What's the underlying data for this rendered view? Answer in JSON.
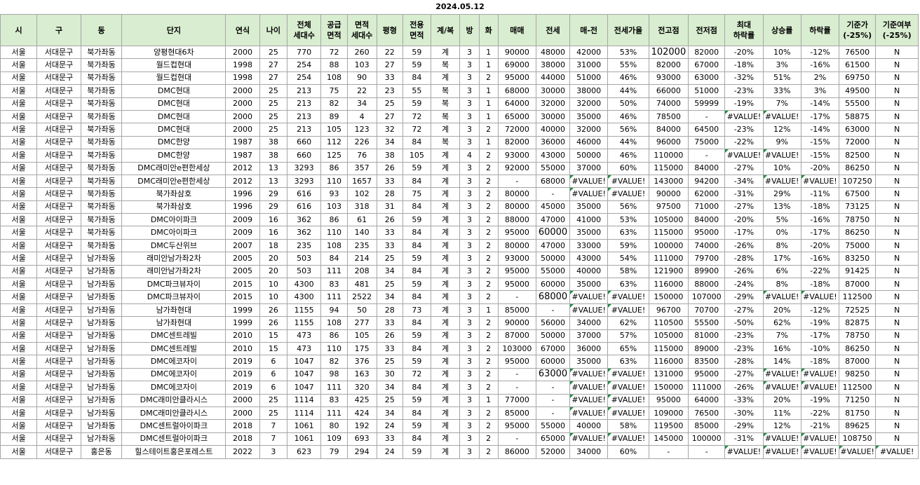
{
  "date": "2024.05.12",
  "headers": [
    "시",
    "구",
    "동",
    "단지",
    "연식",
    "나이",
    "전체\n세대수",
    "공급\n면적",
    "면적\n세대수",
    "평형",
    "전용\n면적",
    "계/복",
    "방",
    "화",
    "매매",
    "전세",
    "매-전",
    "전세가율",
    "전고점",
    "전저점",
    "최대\n하락률",
    "상승률",
    "하락률",
    "기준가\n(-25%)",
    "기준여부\n(-25%)"
  ],
  "rows": [
    [
      "서울",
      "서대문구",
      "북가좌동",
      "양평현대6차",
      "2000",
      "25",
      "770",
      "72",
      "260",
      "22",
      "59",
      "계",
      "3",
      "1",
      "90000",
      "48000",
      "42000",
      "53%",
      "102000",
      "82000",
      "-20%",
      "10%",
      "-12%",
      "76500",
      "N"
    ],
    [
      "서울",
      "서대문구",
      "북가좌동",
      "월드컵현대",
      "1998",
      "27",
      "254",
      "88",
      "103",
      "27",
      "59",
      "복",
      "3",
      "1",
      "69000",
      "38000",
      "31000",
      "55%",
      "82000",
      "67000",
      "-18%",
      "3%",
      "-16%",
      "61500",
      "N"
    ],
    [
      "서울",
      "서대문구",
      "북가좌동",
      "월드컵현대",
      "1998",
      "27",
      "254",
      "108",
      "90",
      "33",
      "84",
      "계",
      "3",
      "2",
      "95000",
      "44000",
      "51000",
      "46%",
      "93000",
      "63000",
      "-32%",
      "51%",
      "2%",
      "69750",
      "N"
    ],
    [
      "서울",
      "서대문구",
      "북가좌동",
      "DMC현대",
      "2000",
      "25",
      "213",
      "75",
      "22",
      "23",
      "55",
      "복",
      "3",
      "1",
      "68000",
      "30000",
      "38000",
      "44%",
      "66000",
      "51000",
      "-23%",
      "33%",
      "3%",
      "49500",
      "N"
    ],
    [
      "서울",
      "서대문구",
      "북가좌동",
      "DMC현대",
      "2000",
      "25",
      "213",
      "82",
      "34",
      "25",
      "59",
      "복",
      "3",
      "1",
      "64000",
      "32000",
      "32000",
      "50%",
      "74000",
      "59999",
      "-19%",
      "7%",
      "-14%",
      "55500",
      "N"
    ],
    [
      "서울",
      "서대문구",
      "북가좌동",
      "DMC현대",
      "2000",
      "25",
      "213",
      "89",
      "4",
      "27",
      "72",
      "복",
      "3",
      "1",
      "65000",
      "30000",
      "35000",
      "46%",
      "78500",
      "-",
      "#VALUE!",
      "#VALUE!",
      "-17%",
      "58875",
      "N"
    ],
    [
      "서울",
      "서대문구",
      "북가좌동",
      "DMC현대",
      "2000",
      "25",
      "213",
      "105",
      "123",
      "32",
      "72",
      "계",
      "3",
      "2",
      "72000",
      "40000",
      "32000",
      "56%",
      "84000",
      "64500",
      "-23%",
      "12%",
      "-14%",
      "63000",
      "N"
    ],
    [
      "서울",
      "서대문구",
      "북가좌동",
      "DMC한양",
      "1987",
      "38",
      "660",
      "112",
      "226",
      "34",
      "84",
      "복",
      "3",
      "1",
      "82000",
      "36000",
      "46000",
      "44%",
      "96000",
      "75000",
      "-22%",
      "9%",
      "-15%",
      "72000",
      "N"
    ],
    [
      "서울",
      "서대문구",
      "북가좌동",
      "DMC한양",
      "1987",
      "38",
      "660",
      "125",
      "76",
      "38",
      "105",
      "계",
      "4",
      "2",
      "93000",
      "43000",
      "50000",
      "46%",
      "110000",
      "-",
      "#VALUE!",
      "#VALUE!",
      "-15%",
      "82500",
      "N"
    ],
    [
      "서울",
      "서대문구",
      "북가좌동",
      "DMC래미안e편한세상",
      "2012",
      "13",
      "3293",
      "86",
      "357",
      "26",
      "59",
      "계",
      "3",
      "2",
      "92000",
      "55000",
      "37000",
      "60%",
      "115000",
      "84000",
      "-27%",
      "10%",
      "-20%",
      "86250",
      "N"
    ],
    [
      "서울",
      "서대문구",
      "북가좌동",
      "DMC래미안e편한세상",
      "2012",
      "13",
      "3293",
      "110",
      "1657",
      "33",
      "84",
      "계",
      "3",
      "2",
      "-",
      "68000",
      "#VALUE!",
      "#VALUE!",
      "143000",
      "94200",
      "-34%",
      "#VALUE!",
      "#VALUE!",
      "107250",
      "N"
    ],
    [
      "서울",
      "서대문구",
      "북가좌동",
      "북가좌삼호",
      "1996",
      "29",
      "616",
      "93",
      "102",
      "28",
      "75",
      "계",
      "3",
      "2",
      "80000",
      "-",
      "#VALUE!",
      "#VALUE!",
      "90000",
      "62000",
      "-31%",
      "29%",
      "-11%",
      "67500",
      "N"
    ],
    [
      "서울",
      "서대문구",
      "북가좌동",
      "북가좌삼호",
      "1996",
      "29",
      "616",
      "103",
      "318",
      "31",
      "84",
      "계",
      "3",
      "2",
      "80000",
      "45000",
      "35000",
      "56%",
      "97500",
      "71000",
      "-27%",
      "13%",
      "-18%",
      "73125",
      "N"
    ],
    [
      "서울",
      "서대문구",
      "북가좌동",
      "DMC아이파크",
      "2009",
      "16",
      "362",
      "86",
      "61",
      "26",
      "59",
      "계",
      "3",
      "2",
      "88000",
      "47000",
      "41000",
      "53%",
      "105000",
      "84000",
      "-20%",
      "5%",
      "-16%",
      "78750",
      "N"
    ],
    [
      "서울",
      "서대문구",
      "북가좌동",
      "DMC아이파크",
      "2009",
      "16",
      "362",
      "110",
      "140",
      "33",
      "84",
      "계",
      "3",
      "2",
      "95000",
      "60000",
      "35000",
      "63%",
      "115000",
      "95000",
      "-17%",
      "0%",
      "-17%",
      "86250",
      "N"
    ],
    [
      "서울",
      "서대문구",
      "북가좌동",
      "DMC두산위브",
      "2007",
      "18",
      "235",
      "108",
      "235",
      "33",
      "84",
      "계",
      "3",
      "2",
      "80000",
      "47000",
      "33000",
      "59%",
      "100000",
      "74000",
      "-26%",
      "8%",
      "-20%",
      "75000",
      "N"
    ],
    [
      "서울",
      "서대문구",
      "남가좌동",
      "래미안남가좌2차",
      "2005",
      "20",
      "503",
      "84",
      "214",
      "25",
      "59",
      "계",
      "3",
      "2",
      "93000",
      "50000",
      "43000",
      "54%",
      "111000",
      "79700",
      "-28%",
      "17%",
      "-16%",
      "83250",
      "N"
    ],
    [
      "서울",
      "서대문구",
      "남가좌동",
      "래미안남가좌2차",
      "2005",
      "20",
      "503",
      "111",
      "208",
      "34",
      "84",
      "계",
      "3",
      "2",
      "95000",
      "55000",
      "40000",
      "58%",
      "121900",
      "89900",
      "-26%",
      "6%",
      "-22%",
      "91425",
      "N"
    ],
    [
      "서울",
      "서대문구",
      "남가좌동",
      "DMC파크뷰자이",
      "2015",
      "10",
      "4300",
      "83",
      "481",
      "25",
      "59",
      "계",
      "3",
      "2",
      "95000",
      "60000",
      "35000",
      "63%",
      "116000",
      "88000",
      "-24%",
      "8%",
      "-18%",
      "87000",
      "N"
    ],
    [
      "서울",
      "서대문구",
      "남가좌동",
      "DMC파크뷰자이",
      "2015",
      "10",
      "4300",
      "111",
      "2522",
      "34",
      "84",
      "계",
      "3",
      "2",
      "-",
      "68000",
      "#VALUE!",
      "#VALUE!",
      "150000",
      "107000",
      "-29%",
      "#VALUE!",
      "#VALUE!",
      "112500",
      "N"
    ],
    [
      "서울",
      "서대문구",
      "남가좌동",
      "남가좌현대",
      "1999",
      "26",
      "1155",
      "94",
      "50",
      "28",
      "73",
      "계",
      "3",
      "1",
      "85000",
      "-",
      "#VALUE!",
      "#VALUE!",
      "96700",
      "70700",
      "-27%",
      "20%",
      "-12%",
      "72525",
      "N"
    ],
    [
      "서울",
      "서대문구",
      "남가좌동",
      "남가좌현대",
      "1999",
      "26",
      "1155",
      "108",
      "277",
      "33",
      "84",
      "계",
      "3",
      "2",
      "90000",
      "56000",
      "34000",
      "62%",
      "110500",
      "55500",
      "-50%",
      "62%",
      "-19%",
      "82875",
      "N"
    ],
    [
      "서울",
      "서대문구",
      "남가좌동",
      "DMC센트레빌",
      "2010",
      "15",
      "473",
      "86",
      "105",
      "26",
      "59",
      "계",
      "3",
      "2",
      "87000",
      "50000",
      "37000",
      "57%",
      "105000",
      "81000",
      "-23%",
      "7%",
      "-17%",
      "78750",
      "N"
    ],
    [
      "서울",
      "서대문구",
      "남가좌동",
      "DMC센트레빌",
      "2010",
      "15",
      "473",
      "110",
      "175",
      "33",
      "84",
      "계",
      "3",
      "2",
      "103000",
      "67000",
      "36000",
      "65%",
      "115000",
      "89000",
      "-23%",
      "16%",
      "-10%",
      "86250",
      "N"
    ],
    [
      "서울",
      "서대문구",
      "남가좌동",
      "DMC에코자이",
      "2019",
      "6",
      "1047",
      "82",
      "376",
      "25",
      "59",
      "계",
      "3",
      "2",
      "95000",
      "60000",
      "35000",
      "63%",
      "116000",
      "83500",
      "-28%",
      "14%",
      "-18%",
      "87000",
      "N"
    ],
    [
      "서울",
      "서대문구",
      "남가좌동",
      "DMC에코자이",
      "2019",
      "6",
      "1047",
      "98",
      "163",
      "30",
      "72",
      "계",
      "3",
      "2",
      "-",
      "63000",
      "#VALUE!",
      "#VALUE!",
      "131000",
      "95000",
      "-27%",
      "#VALUE!",
      "#VALUE!",
      "98250",
      "N"
    ],
    [
      "서울",
      "서대문구",
      "남가좌동",
      "DMC에코자이",
      "2019",
      "6",
      "1047",
      "111",
      "320",
      "34",
      "84",
      "계",
      "3",
      "2",
      "-",
      "-",
      "#VALUE!",
      "#VALUE!",
      "150000",
      "111000",
      "-26%",
      "#VALUE!",
      "#VALUE!",
      "112500",
      "N"
    ],
    [
      "서울",
      "서대문구",
      "남가좌동",
      "DMC래미안클라시스",
      "2000",
      "25",
      "1114",
      "83",
      "425",
      "25",
      "59",
      "계",
      "3",
      "1",
      "77000",
      "-",
      "#VALUE!",
      "#VALUE!",
      "95000",
      "64000",
      "-33%",
      "20%",
      "-19%",
      "71250",
      "N"
    ],
    [
      "서울",
      "서대문구",
      "남가좌동",
      "DMC래미안클라시스",
      "2000",
      "25",
      "1114",
      "111",
      "424",
      "34",
      "84",
      "계",
      "3",
      "2",
      "85000",
      "-",
      "#VALUE!",
      "#VALUE!",
      "109000",
      "76500",
      "-30%",
      "11%",
      "-22%",
      "81750",
      "N"
    ],
    [
      "서울",
      "서대문구",
      "남가좌동",
      "DMC센트럴아이파크",
      "2018",
      "7",
      "1061",
      "80",
      "192",
      "24",
      "59",
      "계",
      "3",
      "2",
      "95000",
      "55000",
      "40000",
      "58%",
      "119500",
      "85000",
      "-29%",
      "12%",
      "-21%",
      "89625",
      "N"
    ],
    [
      "서울",
      "서대문구",
      "남가좌동",
      "DMC센트럴아이파크",
      "2018",
      "7",
      "1061",
      "109",
      "693",
      "33",
      "84",
      "계",
      "3",
      "2",
      "-",
      "65000",
      "#VALUE!",
      "#VALUE!",
      "145000",
      "100000",
      "-31%",
      "#VALUE!",
      "#VALUE!",
      "108750",
      "N"
    ],
    [
      "서울",
      "서대문구",
      "홍은동",
      "힐스테이트홍은포레스트",
      "2022",
      "3",
      "623",
      "79",
      "294",
      "24",
      "59",
      "계",
      "3",
      "2",
      "86000",
      "52000",
      "34000",
      "60%",
      "-",
      "-",
      "#VALUE!",
      "#VALUE!",
      "#VALUE!",
      "#VALUE!",
      "#VALUE!"
    ]
  ]
}
